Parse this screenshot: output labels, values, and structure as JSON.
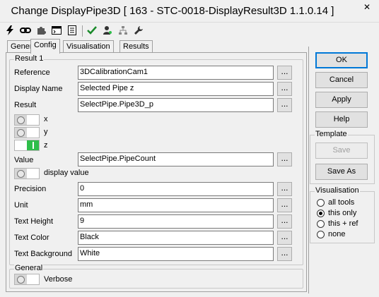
{
  "window": {
    "title": "Change DisplayPipe3D [ 163 - STC-0018-DisplayResult3D 1.1.0.14 ]",
    "close_label": "✕"
  },
  "toolbar": {
    "icons": [
      "lightning-icon",
      "link-icon",
      "puzzle-icon",
      "console-icon",
      "list-icon",
      "check-icon",
      "camera-user-icon",
      "network-icon",
      "wrench-icon"
    ]
  },
  "tabs": [
    {
      "label": "General"
    },
    {
      "label": "Config"
    },
    {
      "label": "Visualisation"
    },
    {
      "label": "Results"
    }
  ],
  "result1": {
    "legend": "Result 1",
    "reference_label": "Reference",
    "reference_value": "3DCalibrationCam1",
    "display_name_label": "Display Name",
    "display_name_value": "Selected Pipe z",
    "result_label": "Result",
    "result_value": "SelectPipe.Pipe3D_p",
    "x_label": "x",
    "y_label": "y",
    "z_label": "z",
    "value_label": "Value",
    "value_value": "SelectPipe.PipeCount",
    "display_value_label": "display value",
    "precision_label": "Precision",
    "precision_value": "0",
    "unit_label": "Unit",
    "unit_value": "mm",
    "text_height_label": "Text Height",
    "text_height_value": "9",
    "text_color_label": "Text Color",
    "text_color_value": "Black",
    "text_background_label": "Text Background",
    "text_background_value": "White",
    "browse_label": "..."
  },
  "general": {
    "legend": "General",
    "verbose_label": "Verbose"
  },
  "buttons": {
    "ok": "OK",
    "cancel": "Cancel",
    "apply": "Apply",
    "help": "Help"
  },
  "template": {
    "legend": "Template",
    "save": "Save",
    "save_as": "Save As"
  },
  "visualisation": {
    "legend": "Visualisation",
    "options": [
      "all tools",
      "this only",
      "this + ref",
      "none"
    ],
    "selected": "this only"
  },
  "colors": {
    "toggle_on": "#2fbe4a",
    "default_button_border": "#0078d7"
  }
}
